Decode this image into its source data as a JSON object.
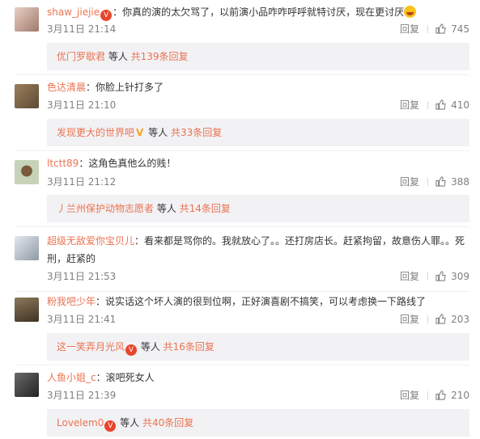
{
  "comments": [
    {
      "user": "shaw_jiejie",
      "text": "：你真的演的太欠骂了，以前演小品咋咋呼呼就特讨厌，现在更讨厌",
      "time": "3月11日 21:14",
      "reply": "回复",
      "likes": "745",
      "more_user": "优门罗歇君",
      "more_text": " 等人 ",
      "more_count": "共139条回复",
      "avatar_color": "#d8b5a8"
    },
    {
      "user": "色达清晨",
      "text": "：你脸上针打多了",
      "time": "3月11日 21:10",
      "reply": "回复",
      "likes": "410",
      "more_user": "发现更大的世界吧",
      "more_text": " 等人 ",
      "more_count": "共33条回复",
      "avatar_color": "#8a6f4f"
    },
    {
      "user": "ltctt89",
      "text": "：这角色真他么的贱！",
      "time": "3月11日 21:12",
      "reply": "回复",
      "likes": "388",
      "more_user": "丿兰州保护动物志愿者",
      "more_text": " 等人 ",
      "more_count": "共14条回复",
      "avatar_color": "#9fb08e"
    },
    {
      "user": "超级无敌爱你宝贝儿",
      "text": "：看来都是骂你的。我就放心了。。还打房店长。赶紧拘留，故意伤人罪。。死刑，赶紧的",
      "time": "3月11日 21:53",
      "reply": "回复",
      "likes": "309",
      "avatar_color": "#b9c3cf"
    },
    {
      "user": "粉我吧少年",
      "text": "：说实话这个坏人演的很到位啊，正好演喜剧不搞笑，可以考虑换一下路线了",
      "time": "3月11日 21:41",
      "reply": "回复",
      "likes": "203",
      "more_user": "这一笑弄月光风",
      "more_text": " 等人 ",
      "more_count": "共16条回复",
      "avatar_color": "#6b5a44"
    },
    {
      "user": "人鱼小姐_c",
      "text": "：滚吧死女人",
      "time": "3月11日 21:39",
      "reply": "回复",
      "likes": "210",
      "more_user": "Lovelem0",
      "more_text": " 等人 ",
      "more_count": "共40条回复",
      "avatar_color": "#4c4c4c"
    }
  ],
  "colors": {
    "username": "#eb7350",
    "meta": "#808080",
    "reply_bg": "#f2f2f5"
  }
}
